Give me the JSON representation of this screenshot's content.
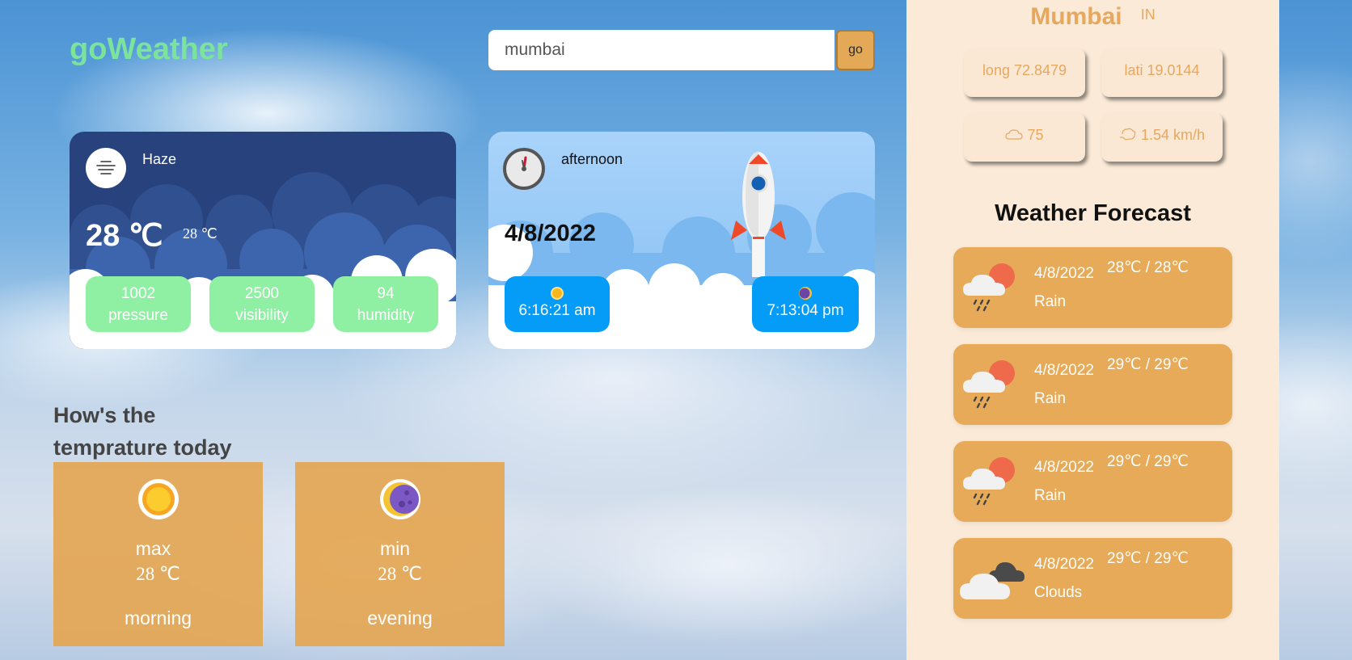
{
  "header": {
    "logo": "goWeather",
    "search_value": "mumbai",
    "go_label": "go"
  },
  "weather_card": {
    "condition": "Haze",
    "temp_main": "28 ℃",
    "temp_feels": "28 ℃",
    "stats": [
      {
        "value": "1002",
        "label": "pressure"
      },
      {
        "value": "2500",
        "label": "visibility"
      },
      {
        "value": "94",
        "label": "humidity"
      }
    ]
  },
  "time_card": {
    "period": "afternoon",
    "date": "4/8/2022",
    "sunrise": "6:16:21 am",
    "sunset": "7:13:04 pm"
  },
  "today": {
    "heading_line1": "How's the",
    "heading_line2": "temprature today",
    "max": {
      "label": "max",
      "value": "28 ℃",
      "part": "morning"
    },
    "min": {
      "label": "min",
      "value": "28 ℃",
      "part": "evening"
    }
  },
  "panel": {
    "city": "Mumbai",
    "country": "IN",
    "longitude": "long 72.8479",
    "latitude": "lati 19.0144",
    "clouds": "75",
    "wind": "1.54 km/h",
    "forecast_title": "Weather Forecast",
    "forecast": [
      {
        "date": "4/8/2022",
        "temps": "28℃ / 28℃",
        "desc": "Rain",
        "icon": "rain-sun-icon"
      },
      {
        "date": "4/8/2022",
        "temps": "29℃ / 29℃",
        "desc": "Rain",
        "icon": "rain-sun-icon"
      },
      {
        "date": "4/8/2022",
        "temps": "29℃ / 29℃",
        "desc": "Rain",
        "icon": "rain-sun-icon"
      },
      {
        "date": "4/8/2022",
        "temps": "29℃ / 29℃",
        "desc": "Clouds",
        "icon": "clouds-icon"
      }
    ]
  },
  "colors": {
    "logo": "#7ae39c",
    "accent_orange": "#e7aa58",
    "stat_green": "#8ff0a4",
    "sun_blue": "#049cf6",
    "panel_bg": "#fbead7"
  }
}
